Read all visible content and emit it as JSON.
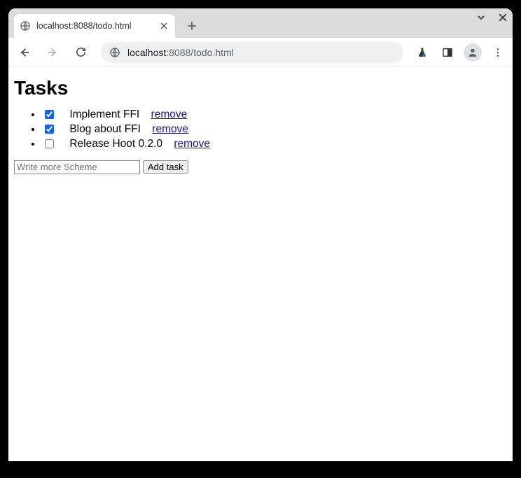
{
  "browser": {
    "tab_title": "localhost:8088/todo.html",
    "url_host": "localhost",
    "url_rest": ":8088/todo.html"
  },
  "page": {
    "heading": "Tasks",
    "tasks": [
      {
        "label": "Implement FFI",
        "done": true,
        "remove": "remove"
      },
      {
        "label": "Blog about FFI",
        "done": true,
        "remove": "remove"
      },
      {
        "label": "Release Hoot 0.2.0",
        "done": false,
        "remove": "remove"
      }
    ],
    "new_task_placeholder": "Write more Scheme",
    "add_button": "Add task"
  }
}
